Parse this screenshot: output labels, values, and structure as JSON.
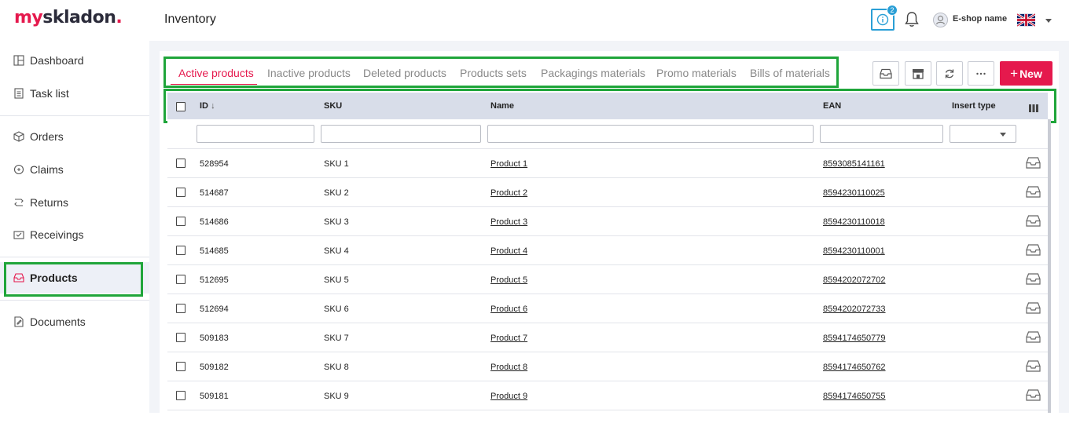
{
  "app": {
    "logo_my": "my",
    "logo_rest": "skladon",
    "logo_dot": ".",
    "page_title": "Inventory",
    "notification_count": "2",
    "user_name": "E-shop name"
  },
  "sidebar": {
    "items": [
      {
        "label": "Dashboard"
      },
      {
        "label": "Task list"
      },
      {
        "label": "Orders"
      },
      {
        "label": "Claims"
      },
      {
        "label": "Returns"
      },
      {
        "label": "Receivings"
      },
      {
        "label": "Products"
      },
      {
        "label": "Documents"
      }
    ]
  },
  "tabs": [
    {
      "label": "Active products"
    },
    {
      "label": "Inactive products"
    },
    {
      "label": "Deleted products"
    },
    {
      "label": "Products sets"
    },
    {
      "label": "Packagings materials"
    },
    {
      "label": "Promo materials"
    },
    {
      "label": "Bills of materials"
    }
  ],
  "toolbar": {
    "new_label": "New"
  },
  "table": {
    "columns": {
      "id": "ID",
      "sku": "SKU",
      "name": "Name",
      "ean": "EAN",
      "insert_type": "Insert type"
    },
    "rows": [
      {
        "id": "528954",
        "sku": "SKU 1",
        "name": "Product 1",
        "ean": "8593085141161"
      },
      {
        "id": "514687",
        "sku": "SKU 2",
        "name": "Product 2",
        "ean": "8594230110025"
      },
      {
        "id": "514686",
        "sku": "SKU 3",
        "name": "Product 3",
        "ean": "8594230110018"
      },
      {
        "id": "514685",
        "sku": "SKU 4",
        "name": "Product 4",
        "ean": "8594230110001"
      },
      {
        "id": "512695",
        "sku": "SKU 5",
        "name": "Product 5",
        "ean": "8594202072702"
      },
      {
        "id": "512694",
        "sku": "SKU 6",
        "name": "Product 6",
        "ean": "8594202072733"
      },
      {
        "id": "509183",
        "sku": "SKU 7",
        "name": "Product 7",
        "ean": "8594174650779"
      },
      {
        "id": "509182",
        "sku": "SKU 8",
        "name": "Product 8",
        "ean": "8594174650762"
      },
      {
        "id": "509181",
        "sku": "SKU 9",
        "name": "Product 9",
        "ean": "8594174650755"
      }
    ]
  },
  "colors": {
    "brand": "#e5194d",
    "info": "#2a9fd6",
    "highlight": "#1fa53a",
    "header_bg": "#d8dde9"
  },
  "icons": {
    "sidebar": [
      "dashboard-icon",
      "task-list-icon",
      "orders-icon",
      "claims-icon",
      "returns-icon",
      "receivings-icon",
      "products-icon",
      "documents-icon"
    ],
    "toolbar": [
      "inbox-icon",
      "store-icon",
      "refresh-icon",
      "more-icon"
    ],
    "row": "inbox-icon"
  }
}
